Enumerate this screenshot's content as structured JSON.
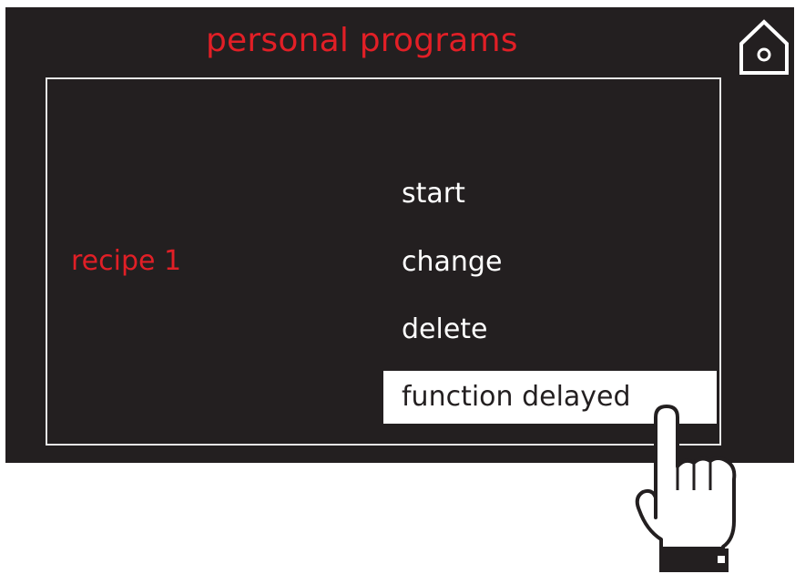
{
  "header": {
    "title": "personal programs"
  },
  "icons": {
    "home": "home-icon",
    "pointer": "pointing-hand-icon"
  },
  "recipe": {
    "name": "recipe 1"
  },
  "menu": {
    "items": [
      {
        "label": "start"
      },
      {
        "label": "change"
      },
      {
        "label": "delete"
      },
      {
        "label": "function delayed",
        "selected": true
      }
    ]
  },
  "colors": {
    "screen_bg": "#231f20",
    "accent_red": "#e11f26",
    "text": "#ffffff",
    "highlight": "#ffffff"
  }
}
